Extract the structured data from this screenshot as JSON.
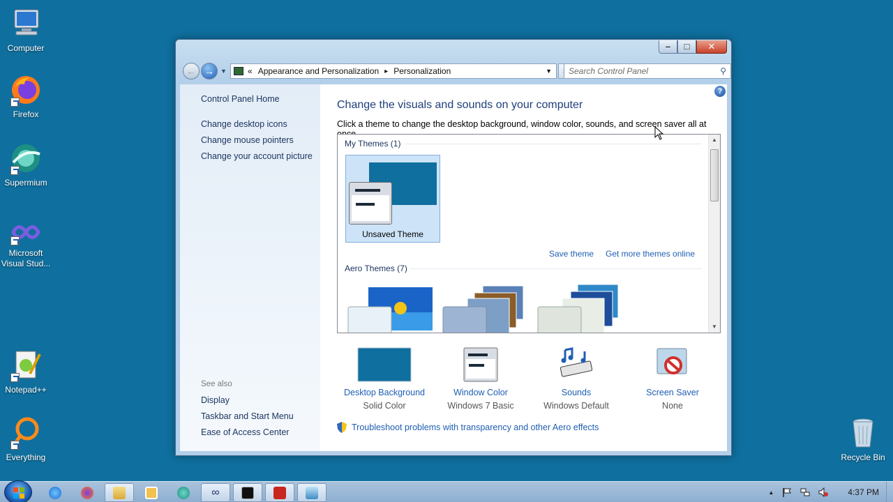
{
  "desktop": {
    "icons": [
      {
        "label": "Computer"
      },
      {
        "label": "Firefox"
      },
      {
        "label": "Supermium"
      },
      {
        "label": "Microsoft Visual Stud..."
      },
      {
        "label": "Notepad++"
      },
      {
        "label": "Everything"
      },
      {
        "label": "Recycle Bin"
      }
    ]
  },
  "window": {
    "caption": {
      "minimize": "–",
      "maximize": "□",
      "close": "✕"
    },
    "address": {
      "prefix": "«",
      "crumbs": [
        "Appearance and Personalization",
        "Personalization"
      ],
      "separator": "▸"
    },
    "search_placeholder": "Search Control Panel"
  },
  "left_pane": {
    "home": "Control Panel Home",
    "links": [
      "Change desktop icons",
      "Change mouse pointers",
      "Change your account picture"
    ],
    "see_also_title": "See also",
    "see_also": [
      "Display",
      "Taskbar and Start Menu",
      "Ease of Access Center"
    ]
  },
  "main": {
    "heading": "Change the visuals and sounds on your computer",
    "subtitle": "Click a theme to change the desktop background, window color, sounds, and screen saver all at once.",
    "my_themes_title": "My Themes (1)",
    "unsaved_theme": "Unsaved Theme",
    "save_theme": "Save theme",
    "get_more": "Get more themes online",
    "aero_themes_title": "Aero Themes (7)",
    "bottom": [
      {
        "label": "Desktop Background",
        "value": "Solid Color"
      },
      {
        "label": "Window Color",
        "value": "Windows 7 Basic"
      },
      {
        "label": "Sounds",
        "value": "Windows Default"
      },
      {
        "label": "Screen Saver",
        "value": "None"
      }
    ],
    "troubleshoot": "Troubleshoot problems with transparency and other Aero effects"
  },
  "taskbar": {
    "clock": "4:37 PM",
    "tray_up_arrow": "▲"
  },
  "colors": {
    "desktop": "#0f6f9e",
    "link": "#1f5fb3",
    "heading": "#1f3f7a"
  }
}
